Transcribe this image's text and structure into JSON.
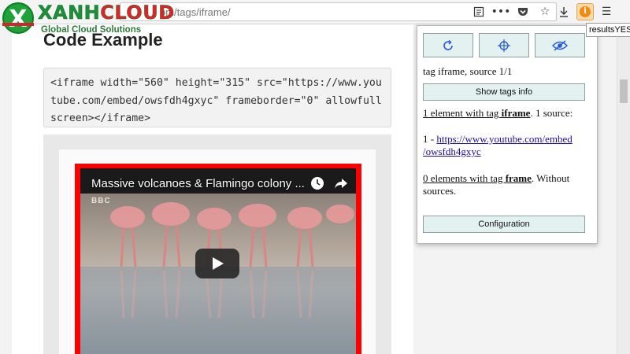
{
  "logo": {
    "mark": "X",
    "word_a": "XANH",
    "word_b": "CLOUD",
    "subtitle": "Global Cloud Solutions"
  },
  "browser": {
    "url": "om/tags/iframe/",
    "tooltip": "resultsYES"
  },
  "page": {
    "title": "Code Example",
    "code": "<iframe width=\"560\" height=\"315\" src=\"https://www.youtube.com/embed/owsfdh4gxyc\" frameborder=\"0\" allowfullscreen></iframe>",
    "video_title": "Massive volcanoes & Flamingo colony ...",
    "video_watermark": "BBC"
  },
  "popup": {
    "buttons": [
      {
        "name": "refresh-icon"
      },
      {
        "name": "crosshair-icon"
      },
      {
        "name": "eye-off-icon"
      }
    ],
    "status": "tag iframe, source 1/1",
    "show_tags_label": "Show tags info",
    "iframe_count_link": "1 element with tag ",
    "iframe_tag": "iframe",
    "iframe_sources": ". 1 source:",
    "source_index": "1 - ",
    "source_url_line1": "https://www.youtube.com/embed",
    "source_url_line2": "/owsfdh4gxyc",
    "frame_count_link": "0 elements with tag ",
    "frame_tag": "frame",
    "frame_suffix_line1": ". Without",
    "frame_suffix_line2": "sources.",
    "config_label": "Configuration"
  },
  "colors": {
    "accent_green": "#1e8e3a",
    "accent_red": "#e0232b",
    "video_border": "#ff0000",
    "popup_button_bg": "#e3f1f1"
  }
}
